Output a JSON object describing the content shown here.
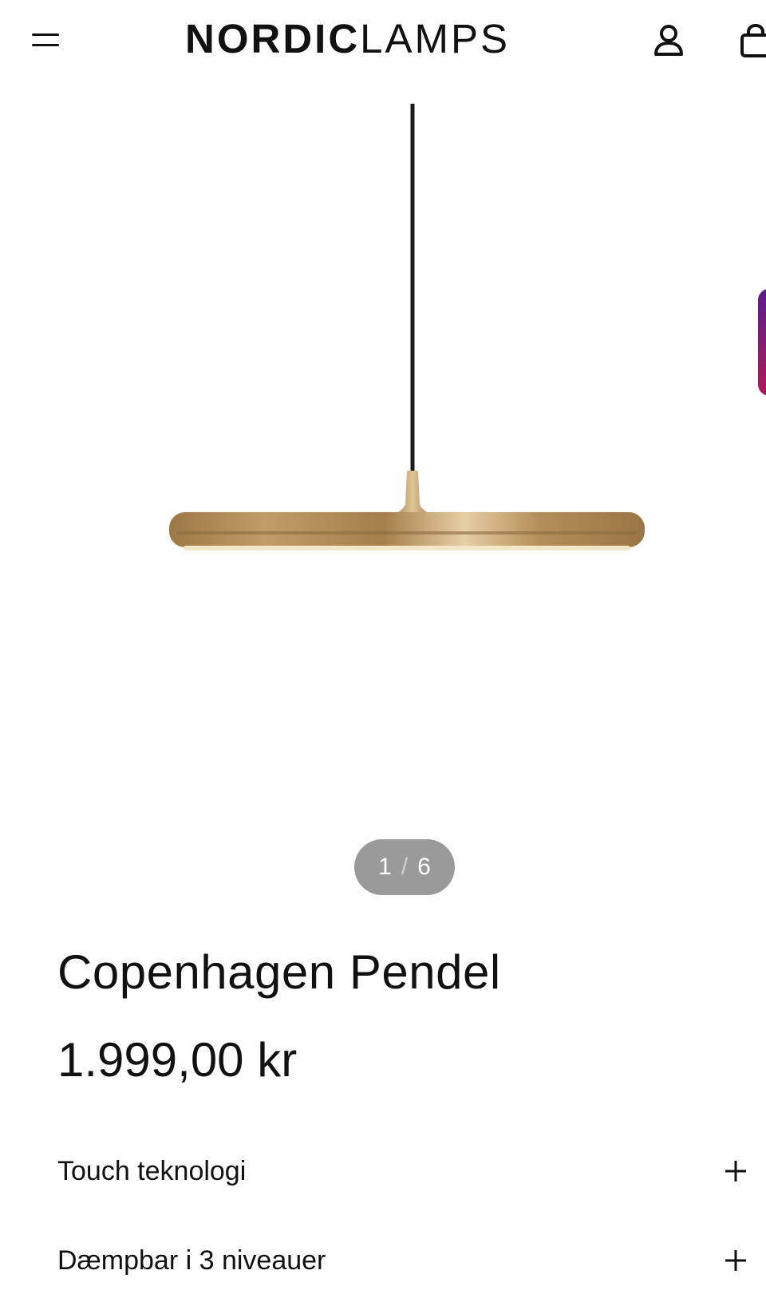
{
  "header": {
    "logo_bold": "NORDIC",
    "logo_thin": "LAMPS",
    "menu_icon": "hamburger-menu-icon",
    "account_icon": "user-account-icon",
    "cart_icon": "shopping-bag-icon"
  },
  "gallery": {
    "current": "1",
    "separator": "/",
    "total": "6"
  },
  "product": {
    "title": "Copenhagen Pendel",
    "price": "1.999,00 kr"
  },
  "features": [
    {
      "label": "Touch teknologi",
      "icon": "plus-icon"
    },
    {
      "label": "Dæmpbar i 3 niveauer",
      "icon": "plus-icon"
    }
  ],
  "colors": {
    "brass": "#b8935a",
    "pager_bg": "#9a9a9a",
    "side_tab": "#8a1d6b"
  }
}
